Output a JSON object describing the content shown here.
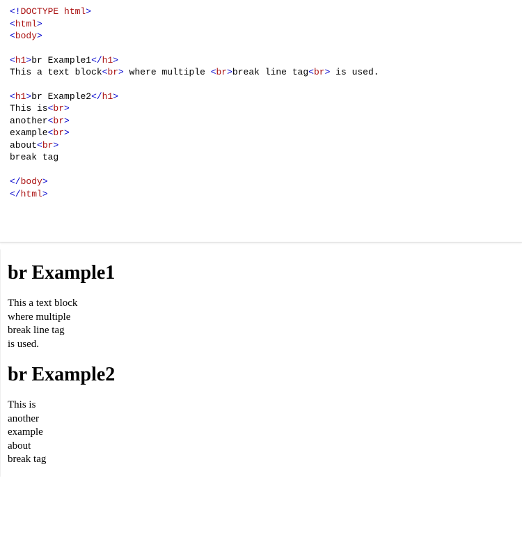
{
  "code": {
    "line1": {
      "b1": "<!",
      "n1": "DOCTYPE",
      "sp": " ",
      "n2": "html",
      "b2": ">"
    },
    "line2": {
      "b1": "<",
      "n": "html",
      "b2": ">"
    },
    "line3": {
      "b1": "<",
      "n": "body",
      "b2": ">"
    },
    "line5": {
      "b1": "<",
      "n1": "h1",
      "b2": ">",
      "txt": "br Example1",
      "b3": "</",
      "n2": "h1",
      "b4": ">"
    },
    "line6": {
      "t1": "This a text block",
      "b1": "<",
      "n1": "br",
      "b2": ">",
      "t2": " where multiple ",
      "b3": "<",
      "n2": "br",
      "b4": ">",
      "t3": "break line tag",
      "b5": "<",
      "n3": "br",
      "b6": ">",
      "t4": " is used."
    },
    "line8": {
      "b1": "<",
      "n1": "h1",
      "b2": ">",
      "txt": "br Example2",
      "b3": "</",
      "n2": "h1",
      "b4": ">"
    },
    "line9": {
      "t": "This is",
      "b1": "<",
      "n": "br",
      "b2": ">"
    },
    "line10": {
      "t": "another",
      "b1": "<",
      "n": "br",
      "b2": ">"
    },
    "line11": {
      "t": "example",
      "b1": "<",
      "n": "br",
      "b2": ">"
    },
    "line12": {
      "t": "about",
      "b1": "<",
      "n": "br",
      "b2": ">"
    },
    "line13": {
      "t": "break tag"
    },
    "line15": {
      "b1": "</",
      "n": "body",
      "b2": ">"
    },
    "line16": {
      "b1": "</",
      "n": "html",
      "b2": ">"
    }
  },
  "preview": {
    "h1_a": "br Example1",
    "p1_l1": "This a text block",
    "p1_l2": "where multiple",
    "p1_l3": "break line tag",
    "p1_l4": "is used.",
    "h1_b": "br Example2",
    "p2_l1": "This is",
    "p2_l2": "another",
    "p2_l3": "example",
    "p2_l4": "about",
    "p2_l5": "break tag"
  }
}
